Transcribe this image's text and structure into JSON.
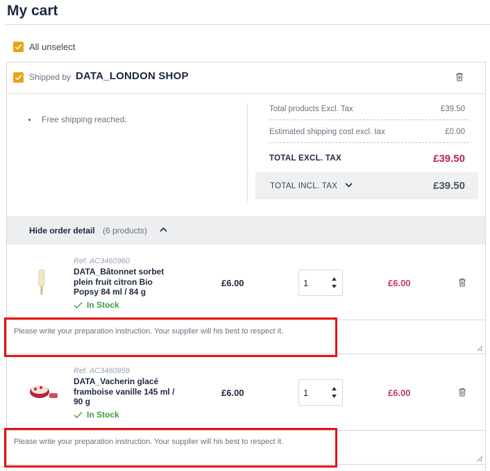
{
  "page": {
    "title": "My cart"
  },
  "cart": {
    "all_unselect_label": "All unselect",
    "shipped_by_label": "Shipped by",
    "shop_name": "DATA_LONDON SHOP",
    "free_shipping_text": "Free shipping reached.",
    "summary": {
      "total_products_label": "Total products Excl. Tax",
      "total_products_value": "£39.50",
      "shipping_label": "Estimated shipping cost excl. tax",
      "shipping_value": "£0.00",
      "total_excl_label": "TOTAL EXCL. TAX",
      "total_excl_value": "£39.50",
      "total_incl_label": "TOTAL INCL. TAX",
      "total_incl_value": "£39.50"
    },
    "order_detail": {
      "label": "Hide order detail",
      "count": "(6 products)"
    },
    "products": [
      {
        "ref": "Ref. AC3460960",
        "name": "DATA_Bâtonnet sorbet plein fruit citron Bio Popsy 84 ml / 84 g",
        "stock": "In Stock",
        "unit_price": "£6.00",
        "quantity": "1",
        "line_price": "£6.00",
        "note_placeholder": "Please write your preparation instruction. Your supplier will his best to respect it."
      },
      {
        "ref": "Ref. AC3460959",
        "name": "DATA_Vacherin glacé framboise vanille 145 ml / 90 g",
        "stock": "In Stock",
        "unit_price": "£6.00",
        "quantity": "1",
        "line_price": "£6.00",
        "note_placeholder": "Please write your preparation instruction. Your supplier will his best to respect it."
      }
    ]
  },
  "colors": {
    "accent_checkbox": "#e8a317",
    "price_red": "#c2395b",
    "stock_green": "#3f9a3f",
    "highlight_border": "#e81010"
  },
  "icons": [
    "check-icon",
    "trash-icon",
    "chevron-down-icon",
    "chevron-up-icon",
    "stepper-up-icon",
    "stepper-down-icon",
    "resize-handle-icon"
  ]
}
